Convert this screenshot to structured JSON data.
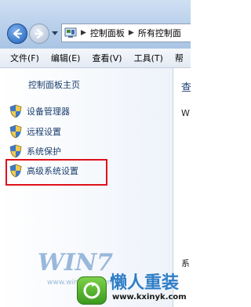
{
  "address": {
    "crumbs": [
      "控制面板",
      "所有控制面"
    ]
  },
  "menu": {
    "items": [
      "文件(F)",
      "编辑(E)",
      "查看(V)",
      "工具(T)",
      "帮"
    ]
  },
  "sidebar": {
    "home": "控制面板主页",
    "items": [
      {
        "label": "设备管理器",
        "icon": "shield-icon"
      },
      {
        "label": "远程设置",
        "icon": "shield-icon"
      },
      {
        "label": "系统保护",
        "icon": "shield-icon"
      },
      {
        "label": "高级系统设置",
        "icon": "shield-icon"
      }
    ]
  },
  "main": {
    "heading": "查",
    "text1": "W",
    "text2": "系"
  },
  "watermark": {
    "logo": "WIN7",
    "logo_sub": "www.win7zhijia.cn",
    "cn": "懒人重装",
    "url": "www.kxinyk.com"
  },
  "colors": {
    "highlight": "#e0111b",
    "link": "#1a3e6e",
    "titlebar": "#b7cfea"
  }
}
